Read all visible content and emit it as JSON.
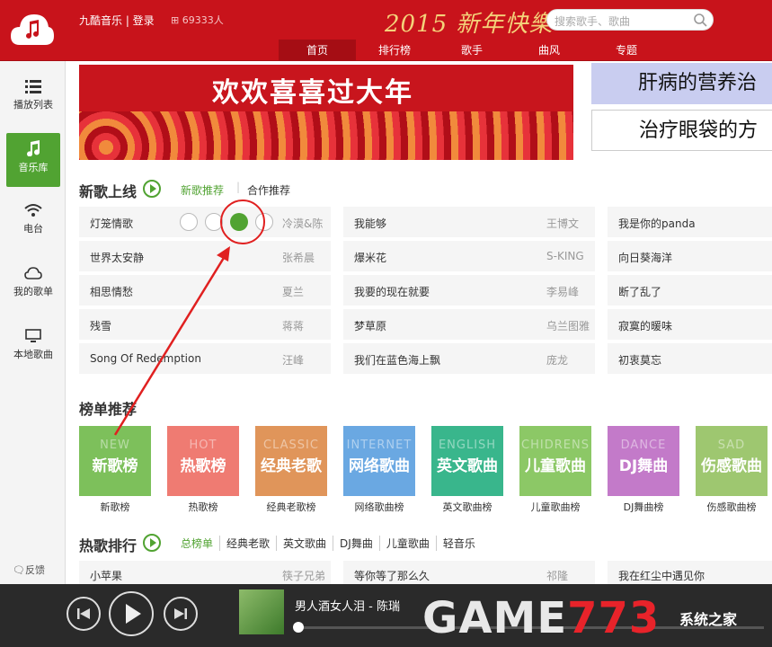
{
  "header": {
    "brand": "九酷音乐 | 登录",
    "online_count": "69333人",
    "banner": "2015 新年快樂",
    "search_placeholder": "搜索歌手、歌曲"
  },
  "nav": [
    "首页",
    "排行榜",
    "歌手",
    "曲风",
    "专题"
  ],
  "sidebar": [
    {
      "label": "播放列表",
      "icon": "list-icon"
    },
    {
      "label": "音乐库",
      "icon": "music-note-icon"
    },
    {
      "label": "电台",
      "icon": "wifi-icon"
    },
    {
      "label": "我的歌单",
      "icon": "cloud-icon"
    },
    {
      "label": "本地歌曲",
      "icon": "monitor-icon"
    }
  ],
  "feedback": "反馈",
  "banner_title": "欢欢喜喜过大年",
  "ads": [
    "肝病的营养治",
    "治疗眼袋的方"
  ],
  "new_songs": {
    "title": "新歌上线",
    "tabs": [
      "新歌推荐",
      "合作推荐"
    ],
    "columns": [
      [
        {
          "song": "灯笼情歌",
          "artist": "冷漠&陈"
        },
        {
          "song": "世界太安静",
          "artist": "张希晨"
        },
        {
          "song": "相思情愁",
          "artist": "夏兰"
        },
        {
          "song": "残雪",
          "artist": "蒋蒋"
        },
        {
          "song": "Song Of Redemption",
          "artist": "汪峰"
        }
      ],
      [
        {
          "song": "我能够",
          "artist": "王博文"
        },
        {
          "song": "爆米花",
          "artist": "S-KING"
        },
        {
          "song": "我要的现在就要",
          "artist": "李易峰"
        },
        {
          "song": "梦草原",
          "artist": "乌兰图雅"
        },
        {
          "song": "我们在蓝色海上飘",
          "artist": "庞龙"
        }
      ],
      [
        {
          "song": "我是你的panda",
          "artist": ""
        },
        {
          "song": "向日葵海洋",
          "artist": ""
        },
        {
          "song": "断了乱了",
          "artist": ""
        },
        {
          "song": "寂寞的暖味",
          "artist": ""
        },
        {
          "song": "初衷莫忘",
          "artist": ""
        }
      ]
    ]
  },
  "charts": {
    "title": "榜单推荐",
    "items": [
      {
        "en": "NEW",
        "zh": "新歌榜",
        "label": "新歌榜",
        "color": "#7dc05b"
      },
      {
        "en": "HOT",
        "zh": "热歌榜",
        "label": "热歌榜",
        "color": "#ef7b72"
      },
      {
        "en": "CLASSIC",
        "zh": "经典老歌",
        "label": "经典老歌榜",
        "color": "#e0955a"
      },
      {
        "en": "INTERNET",
        "zh": "网络歌曲",
        "label": "网络歌曲榜",
        "color": "#6aa8e2"
      },
      {
        "en": "ENGLISH",
        "zh": "英文歌曲",
        "label": "英文歌曲榜",
        "color": "#39b68c"
      },
      {
        "en": "CHIDRENS",
        "zh": "儿童歌曲",
        "label": "儿童歌曲榜",
        "color": "#8cc866"
      },
      {
        "en": "DANCE",
        "zh": "DJ舞曲",
        "label": "DJ舞曲榜",
        "color": "#c37ac9"
      },
      {
        "en": "SAD",
        "zh": "伤感歌曲",
        "label": "伤感歌曲榜",
        "color": "#9ec770"
      }
    ]
  },
  "hot": {
    "title": "热歌排行",
    "tabs": [
      "总榜单",
      "经典老歌",
      "英文歌曲",
      "DJ舞曲",
      "儿童歌曲",
      "轻音乐"
    ],
    "rows": [
      {
        "song": "小苹果",
        "artist": "筷子兄弟"
      },
      {
        "song": "等你等了那么久",
        "artist": "祁隆"
      },
      {
        "song": "我在红尘中遇见你",
        "artist": ""
      }
    ]
  },
  "player": {
    "now_playing": "男人酒女人泪 - 陈瑞"
  },
  "watermark": {
    "text": "GAME773",
    "suffix": "系统之家"
  }
}
